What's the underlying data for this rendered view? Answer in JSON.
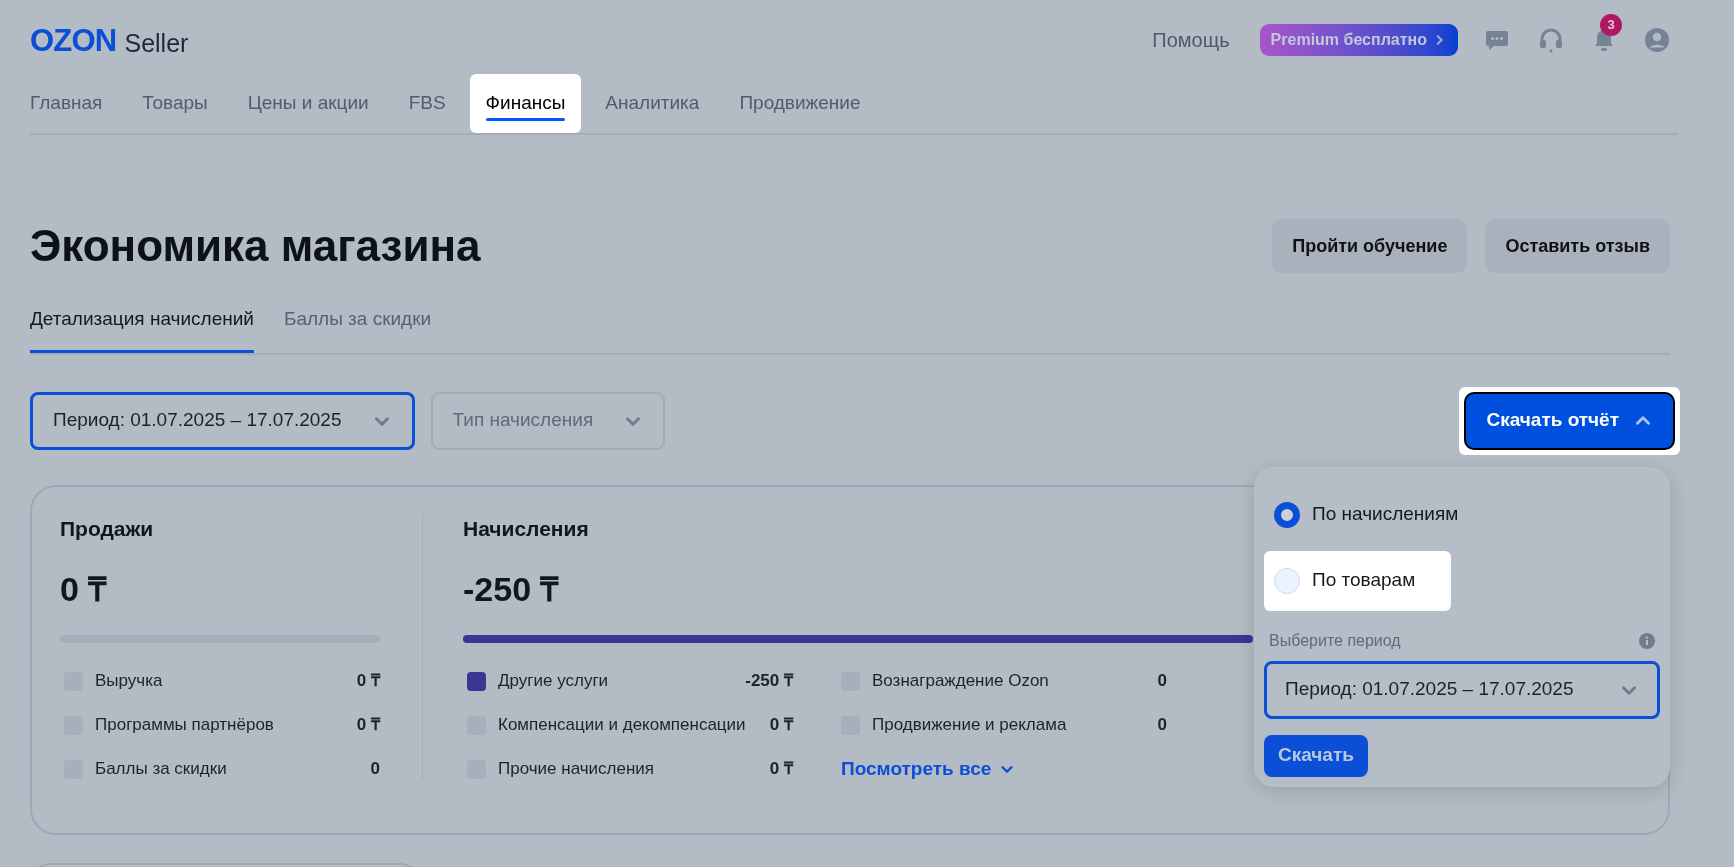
{
  "header": {
    "logo": {
      "brand": "OZON",
      "product": "Seller"
    },
    "help": "Помощь",
    "premium": "Premium бесплатно",
    "notification_count": "3"
  },
  "nav": [
    {
      "label": "Главная",
      "selected": false
    },
    {
      "label": "Товары",
      "selected": false
    },
    {
      "label": "Цены и акции",
      "selected": false
    },
    {
      "label": "FBS",
      "selected": false
    },
    {
      "label": "Финансы",
      "selected": true
    },
    {
      "label": "Аналитика",
      "selected": false
    },
    {
      "label": "Продвижение",
      "selected": false
    }
  ],
  "page_title": "Экономика магазина",
  "header_buttons": [
    "Пройти обучение",
    "Оставить отзыв"
  ],
  "subtabs": [
    {
      "label": "Детализация начислений",
      "selected": true
    },
    {
      "label": "Баллы за скидки",
      "selected": false
    }
  ],
  "filters": [
    {
      "label": "Период: 01.07.2025 – 17.07.2025",
      "focused": true
    },
    {
      "label": "Тип начисления",
      "focused": false
    }
  ],
  "download_button": {
    "label": "Скачать отчёт",
    "expanded": true
  },
  "sales": {
    "title": "Продажи",
    "amount": "0 ₸",
    "level": 0,
    "rows": [
      {
        "label": "Выручка",
        "value": "0 ₸",
        "color": "#a7b0ba"
      },
      {
        "label": "Программы партнёров",
        "value": "0 ₸",
        "color": "#a7b0ba"
      },
      {
        "label": "Баллы за скидки",
        "value": "0",
        "color": "#a7b0ba"
      }
    ]
  },
  "accruals": {
    "title": "Начисления",
    "amount": "-250 ₸",
    "level": 1,
    "columns": [
      [
        {
          "label": "Другие услуги",
          "value": "-250 ₸",
          "color": "#3b3593"
        },
        {
          "label": "Компенсации и декомпенсации",
          "value": "0 ₸",
          "color": "#a7b0ba"
        },
        {
          "label": "Прочие начисления",
          "value": "0 ₸",
          "color": "#a7b0ba"
        }
      ],
      [
        {
          "label": "Вознаграждение Ozon",
          "value": "0",
          "color": "#a7b0ba"
        },
        {
          "label": "Продвижение и реклама",
          "value": "0",
          "color": "#a7b0ba"
        }
      ]
    ],
    "see_all": "Посмотреть все"
  },
  "report_menu": {
    "options": [
      {
        "label": "По начислениям",
        "selected": true
      },
      {
        "label": "По товарам",
        "selected": false
      }
    ],
    "period_label": "Выберите период",
    "period_value": "Период: 01.07.2025 – 17.07.2025",
    "submit": "Скачать"
  }
}
